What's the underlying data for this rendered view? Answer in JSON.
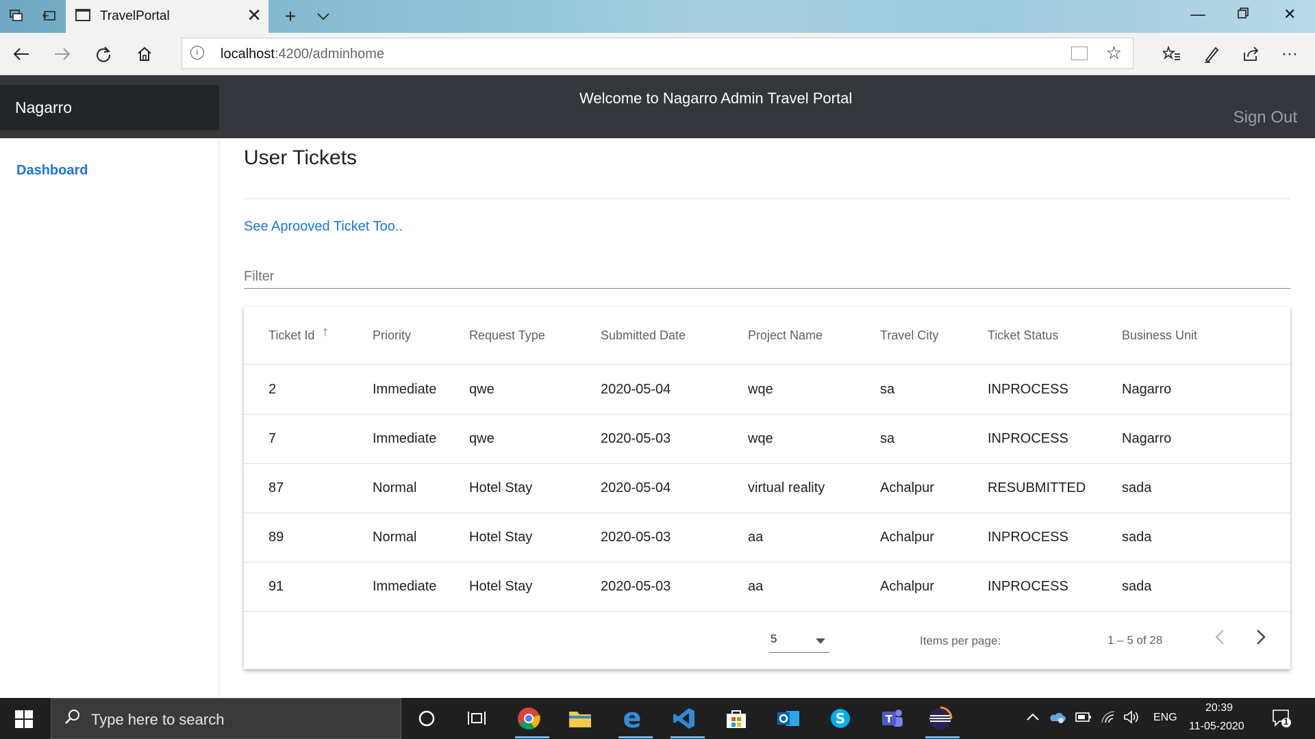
{
  "browser": {
    "tab_title": "TravelPortal",
    "url_host": "localhost",
    "url_rest": ":4200/adminhome"
  },
  "app": {
    "brand": "Nagarro",
    "welcome": "Welcome to Nagarro Admin Travel Portal",
    "sign_out": "Sign Out"
  },
  "sidebar": {
    "items": [
      {
        "label": "Dashboard"
      }
    ]
  },
  "main": {
    "title": "User Tickets",
    "approved_link": "See Aprooved Ticket Too..",
    "filter_placeholder": "Filter"
  },
  "table": {
    "columns": [
      "Ticket Id",
      "Priority",
      "Request Type",
      "Submitted Date",
      "Project Name",
      "Travel City",
      "Ticket Status",
      "Business Unit"
    ],
    "rows": [
      [
        "2",
        "Immediate",
        "qwe",
        "2020-05-04",
        "wqe",
        "sa",
        "INPROCESS",
        "Nagarro"
      ],
      [
        "7",
        "Immediate",
        "qwe",
        "2020-05-03",
        "wqe",
        "sa",
        "INPROCESS",
        "Nagarro"
      ],
      [
        "87",
        "Normal",
        "Hotel Stay",
        "2020-05-04",
        "virtual reality",
        "Achalpur",
        "RESUBMITTED",
        "sada"
      ],
      [
        "89",
        "Normal",
        "Hotel Stay",
        "2020-05-03",
        "aa",
        "Achalpur",
        "INPROCESS",
        "sada"
      ],
      [
        "91",
        "Immediate",
        "Hotel Stay",
        "2020-05-03",
        "aa",
        "Achalpur",
        "INPROCESS",
        "sada"
      ]
    ]
  },
  "paginator": {
    "items_per_page_label": "Items per page:",
    "items_per_page_value": "5",
    "range_label": "1 – 5 of 28"
  },
  "taskbar": {
    "search_placeholder": "Type here to search",
    "language": "ENG",
    "time": "20:39",
    "date": "11-05-2020",
    "notification_count": "1"
  },
  "colors": {
    "header_bg": "#33373b",
    "brand_bg": "#232629",
    "link": "#1a73e8"
  }
}
